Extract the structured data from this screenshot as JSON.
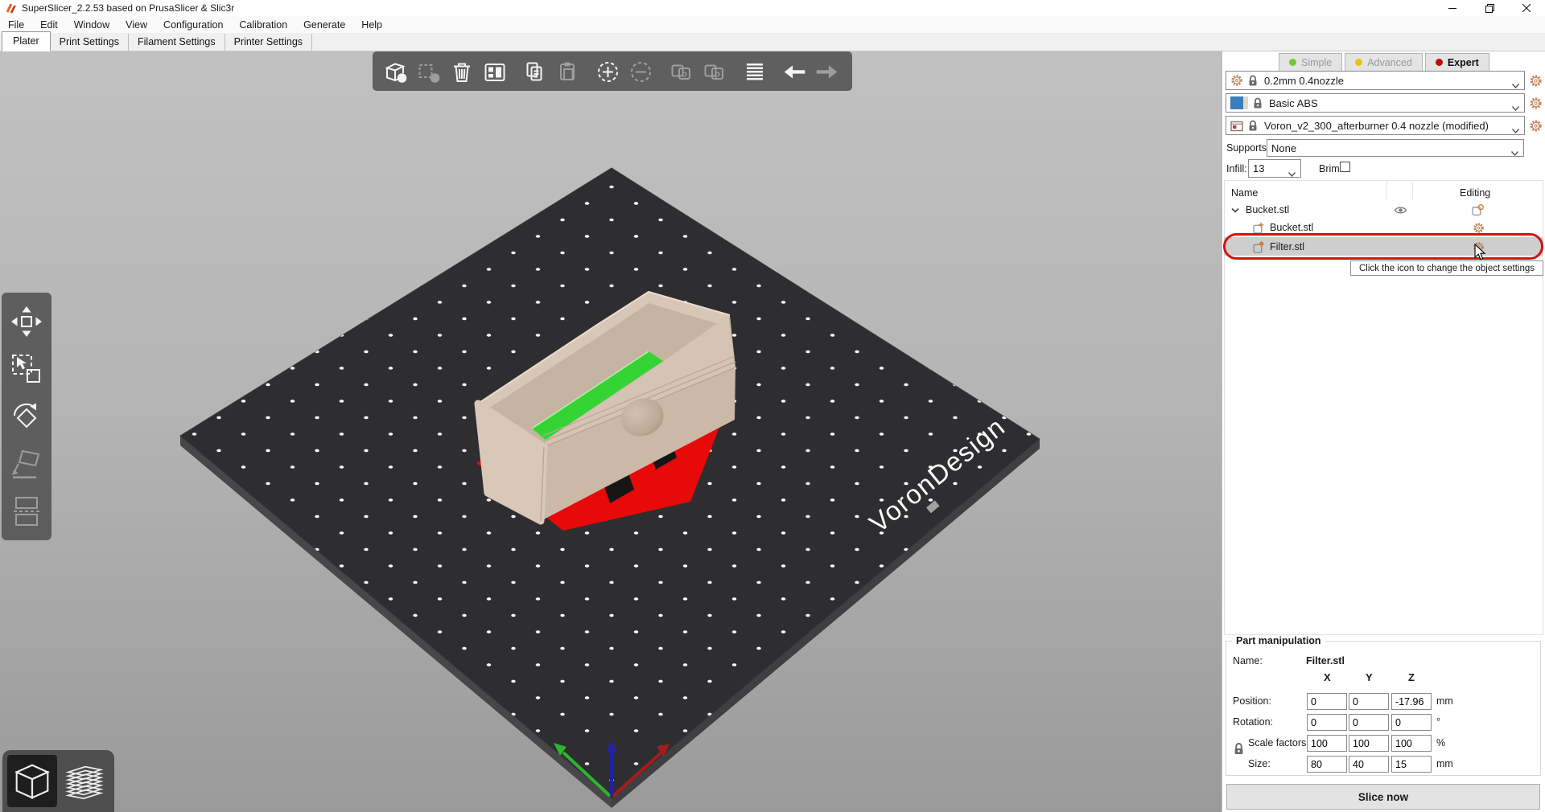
{
  "window": {
    "title": "SuperSlicer_2.2.53 based on PrusaSlicer & Slic3r"
  },
  "menubar": {
    "items": [
      "File",
      "Edit",
      "Window",
      "View",
      "Configuration",
      "Calibration",
      "Generate",
      "Help"
    ]
  },
  "tabbar": {
    "tabs": [
      "Plater",
      "Print Settings",
      "Filament Settings",
      "Printer Settings"
    ],
    "active": "Plater"
  },
  "viewport": {
    "plate_logo": "VoronDesign"
  },
  "top_toolbar": {
    "icons": [
      "add-object",
      "remove-object",
      "delete-all-objects",
      "arrange",
      "copy",
      "paste",
      "add-instance",
      "remove-instance",
      "split-to-objects",
      "split-to-parts",
      "layer-height-table",
      "undo",
      "redo"
    ]
  },
  "left_toolbar": {
    "icons": [
      "move",
      "scale",
      "rotate",
      "place-on-face",
      "cut"
    ]
  },
  "view_toggle": {
    "icons": [
      "3d-editor-view",
      "preview-sliced-view"
    ]
  },
  "sidebar": {
    "modes": [
      {
        "label": "Simple",
        "color": "#6fcb3a"
      },
      {
        "label": "Advanced",
        "color": "#e9c213"
      },
      {
        "label": "Expert",
        "color": "#c00b0b"
      }
    ],
    "presets": {
      "print": "0.2mm 0.4nozzle",
      "filament": "Basic ABS",
      "printer": "Voron_v2_300_afterburner 0.4 nozzle (modified)"
    },
    "supports": {
      "label": "Supports:",
      "value": "None"
    },
    "infill": {
      "label": "Infill:",
      "value": "13"
    },
    "brim": {
      "label": "Brim:"
    },
    "object_list": {
      "name_header": "Name",
      "editing_header": "Editing",
      "rows": [
        {
          "label": "Bucket.stl"
        },
        {
          "label": "Bucket.stl"
        },
        {
          "label": "Filter.stl"
        }
      ]
    },
    "tooltip": "Click the icon to change the object settings",
    "part_manipulation": {
      "title": "Part manipulation",
      "name_label": "Name:",
      "name_value": "Filter.stl",
      "axes": [
        "X",
        "Y",
        "Z"
      ],
      "rows": [
        {
          "label": "Position:",
          "x": "0",
          "y": "0",
          "z": "-17.96",
          "unit": "mm"
        },
        {
          "label": "Rotation:",
          "x": "0",
          "y": "0",
          "z": "0",
          "unit": "°"
        },
        {
          "label": "Scale factors:",
          "x": "100",
          "y": "100",
          "z": "100",
          "unit": "%"
        },
        {
          "label": "Size:",
          "x": "80",
          "y": "40",
          "z": "15",
          "unit": "mm"
        }
      ]
    },
    "slice_button": "Slice now"
  },
  "colors": {
    "accent_orange": "#d97e3e",
    "selection_gray": "#cecece",
    "annotation_red": "#d51212",
    "mode_simple": "#6fcb3a",
    "mode_advanced": "#e9c213",
    "mode_expert": "#c00b0b",
    "filament_swatch_blue": "#3a7dbc",
    "plate": "#2e2e31",
    "model_tan": "#cbb8a7",
    "model_green": "#35d435",
    "model_error_red": "#e80909"
  }
}
